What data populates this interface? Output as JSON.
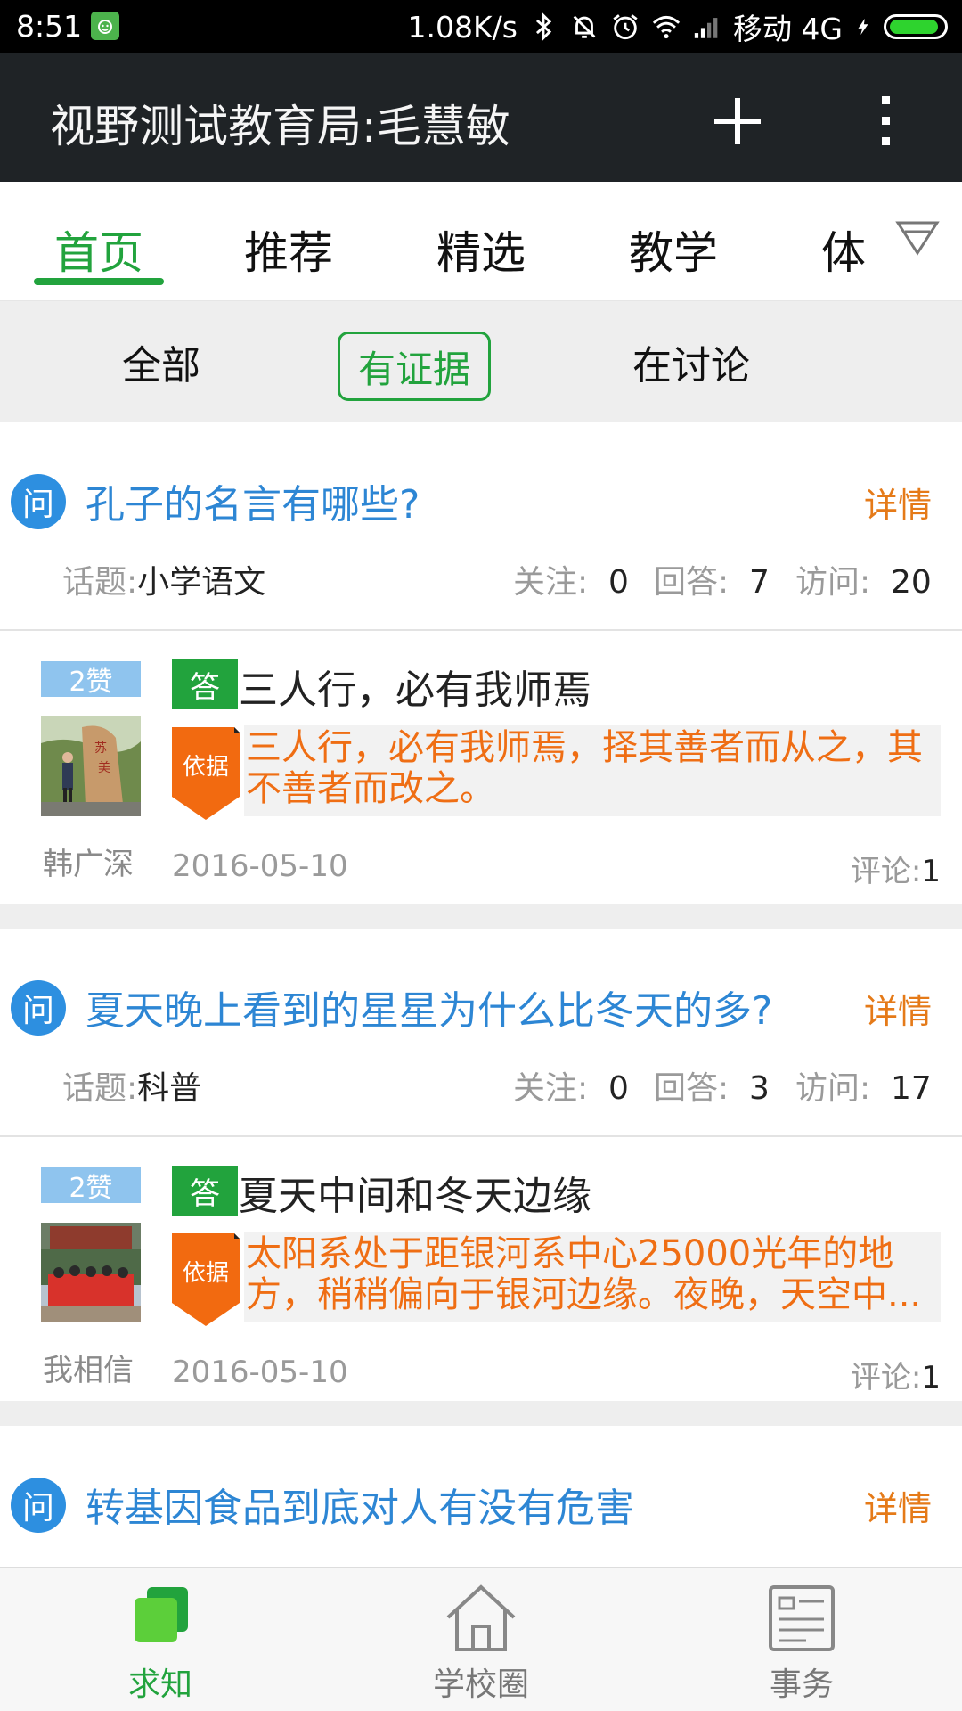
{
  "status_bar": {
    "time": "8:51",
    "net_speed": "1.08K/s",
    "carrier": "移动 4G"
  },
  "header": {
    "title": "视野测试教育局:毛慧敏"
  },
  "tabs": [
    {
      "label": "首页",
      "active": true
    },
    {
      "label": "推荐",
      "active": false
    },
    {
      "label": "精选",
      "active": false
    },
    {
      "label": "教学",
      "active": false
    },
    {
      "label": "体",
      "active": false
    }
  ],
  "filters": [
    {
      "label": "全部",
      "active": false
    },
    {
      "label": "有证据",
      "active": true
    },
    {
      "label": "在讨论",
      "active": false
    }
  ],
  "common": {
    "q_badge": "问",
    "detail": "详情",
    "topic_label": "话题:",
    "follow_label": "关注:",
    "answers_label": "回答:",
    "visits_label": "访问:",
    "answer_badge": "答",
    "basis_badge": "依据",
    "comments_label": "评论:"
  },
  "questions": [
    {
      "title": "孔子的名言有哪些?",
      "topic": "小学语文",
      "follow": "0",
      "answers": "7",
      "visits": "20",
      "answer": {
        "likes": "2赞",
        "author": "韩广深",
        "title": "三人行，必有我师焉",
        "basis": "三人行，必有我师焉，择其善者而从之，其不善者而改之。",
        "date": "2016-05-10",
        "comments": "1"
      }
    },
    {
      "title": "夏天晚上看到的星星为什么比冬天的多?",
      "topic": "科普",
      "follow": "0",
      "answers": "3",
      "visits": "17",
      "answer": {
        "likes": "2赞",
        "author": "我相信",
        "title": "夏天中间和冬天边缘",
        "basis": "太阳系处于距银河系中心25000光年的地方，稍稍偏向于银河边缘。夜晚，天空中...",
        "date": "2016-05-10",
        "comments": "1"
      }
    },
    {
      "title": "转基因食品到底对人有没有危害"
    }
  ],
  "bottom_nav": [
    {
      "label": "求知",
      "icon": "knowledge-icon",
      "active": true
    },
    {
      "label": "学校圈",
      "icon": "home-icon",
      "active": false
    },
    {
      "label": "事务",
      "icon": "document-icon",
      "active": false
    }
  ],
  "colors": {
    "accent": "#22a33d",
    "link": "#2d86d4",
    "orange": "#ef6e14",
    "header_bg": "#1f2326"
  }
}
